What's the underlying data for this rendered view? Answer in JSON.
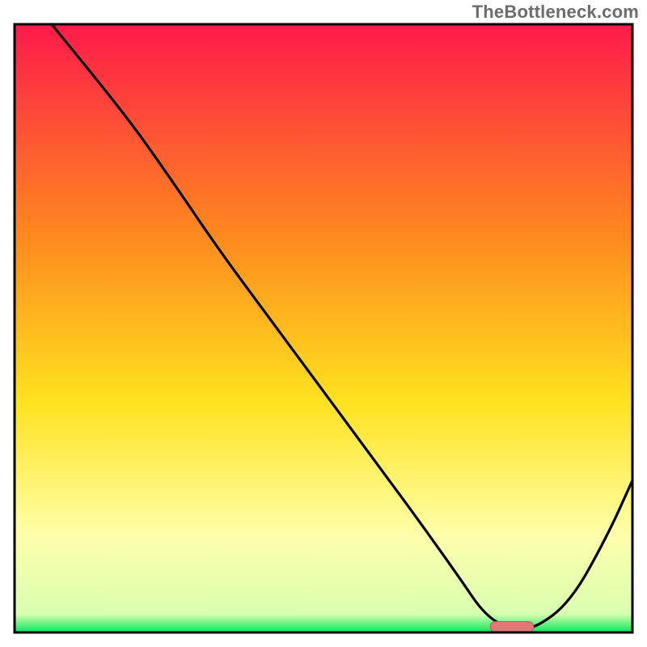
{
  "watermark": "TheBottleneck.com",
  "colors": {
    "gradient_top": "#ff1a4a",
    "gradient_mid1": "#ff8a1e",
    "gradient_mid2": "#ffe21e",
    "gradient_pale": "#ffffaa",
    "gradient_bottom": "#00e85a",
    "frame": "#000000",
    "curve": "#000000",
    "marker_fill": "#e07878",
    "marker_stroke": "#c55a5a"
  },
  "chart_data": {
    "type": "line",
    "title": "",
    "xlabel": "",
    "ylabel": "",
    "xlim": [
      0,
      100
    ],
    "ylim": [
      0,
      100
    ],
    "grid": false,
    "legend": false,
    "series": [
      {
        "name": "bottleneck-curve",
        "x": [
          6,
          18,
          25,
          33,
          41,
          49,
          57,
          65,
          72,
          76,
          80,
          84,
          90,
          96,
          100
        ],
        "y": [
          100,
          85,
          75,
          63,
          52,
          41,
          30,
          19,
          9,
          3,
          0.5,
          0.5,
          5,
          16,
          25
        ]
      }
    ],
    "annotations": [
      {
        "name": "optimal-marker",
        "shape": "rounded-rect",
        "x_range": [
          77,
          84
        ],
        "y": 1,
        "color": "#e07878"
      }
    ],
    "background": {
      "type": "vertical-gradient",
      "stops": [
        {
          "offset": 0.0,
          "color": "#ff1a4a"
        },
        {
          "offset": 0.35,
          "color": "#ff8a1e"
        },
        {
          "offset": 0.62,
          "color": "#ffe21e"
        },
        {
          "offset": 0.84,
          "color": "#ffffaa"
        },
        {
          "offset": 0.97,
          "color": "#d8ffb0"
        },
        {
          "offset": 1.0,
          "color": "#00e85a"
        }
      ]
    }
  }
}
